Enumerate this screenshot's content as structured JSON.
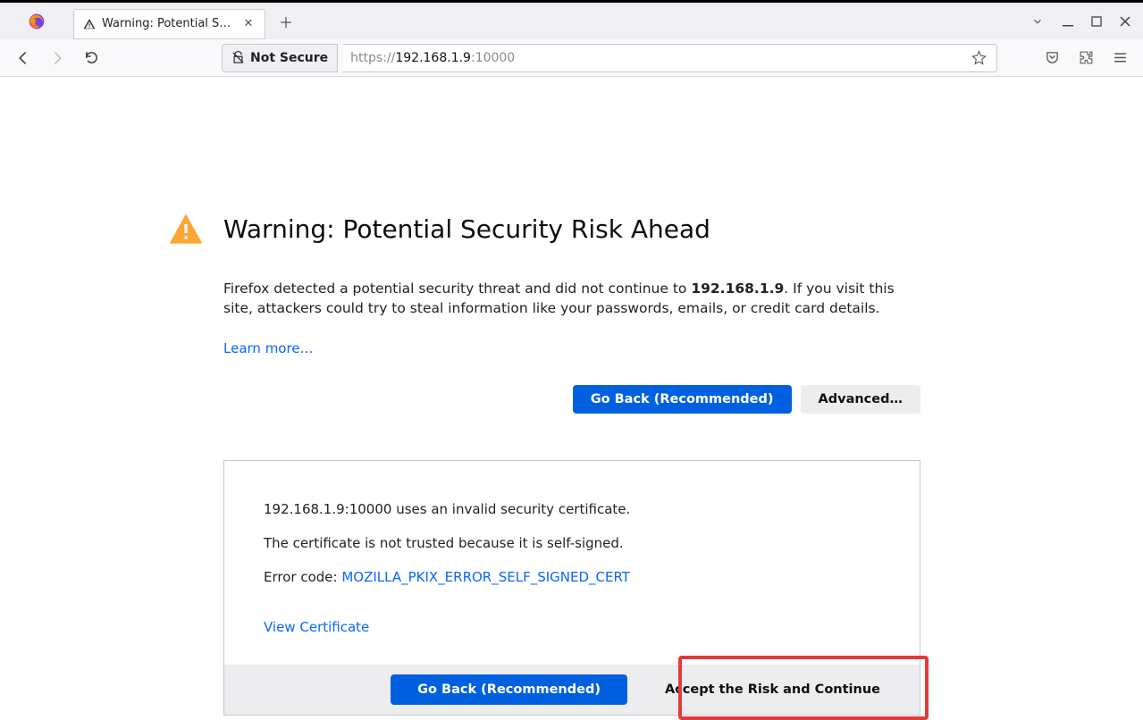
{
  "window": {
    "tab_title": "Warning: Potential Securi",
    "url_scheme": "https://",
    "url_host": "192.168.1.9",
    "url_port": ":10000",
    "security_badge": "Not Secure"
  },
  "page": {
    "title": "Warning: Potential Security Risk Ahead",
    "body_pre": "Firefox detected a potential security threat and did not continue to ",
    "body_host": "192.168.1.9",
    "body_post": ". If you visit this site, attackers could try to steal information like your passwords, emails, or credit card details.",
    "learn_more": "Learn more…",
    "go_back": "Go Back (Recommended)",
    "advanced": "Advanced…"
  },
  "advanced": {
    "line1": "192.168.1.9:10000 uses an invalid security certificate.",
    "line2": "The certificate is not trusted because it is self-signed.",
    "error_label": "Error code: ",
    "error_code": "MOZILLA_PKIX_ERROR_SELF_SIGNED_CERT",
    "view_cert": "View Certificate",
    "go_back2": "Go Back (Recommended)",
    "accept": "Accept the Risk and Continue"
  }
}
